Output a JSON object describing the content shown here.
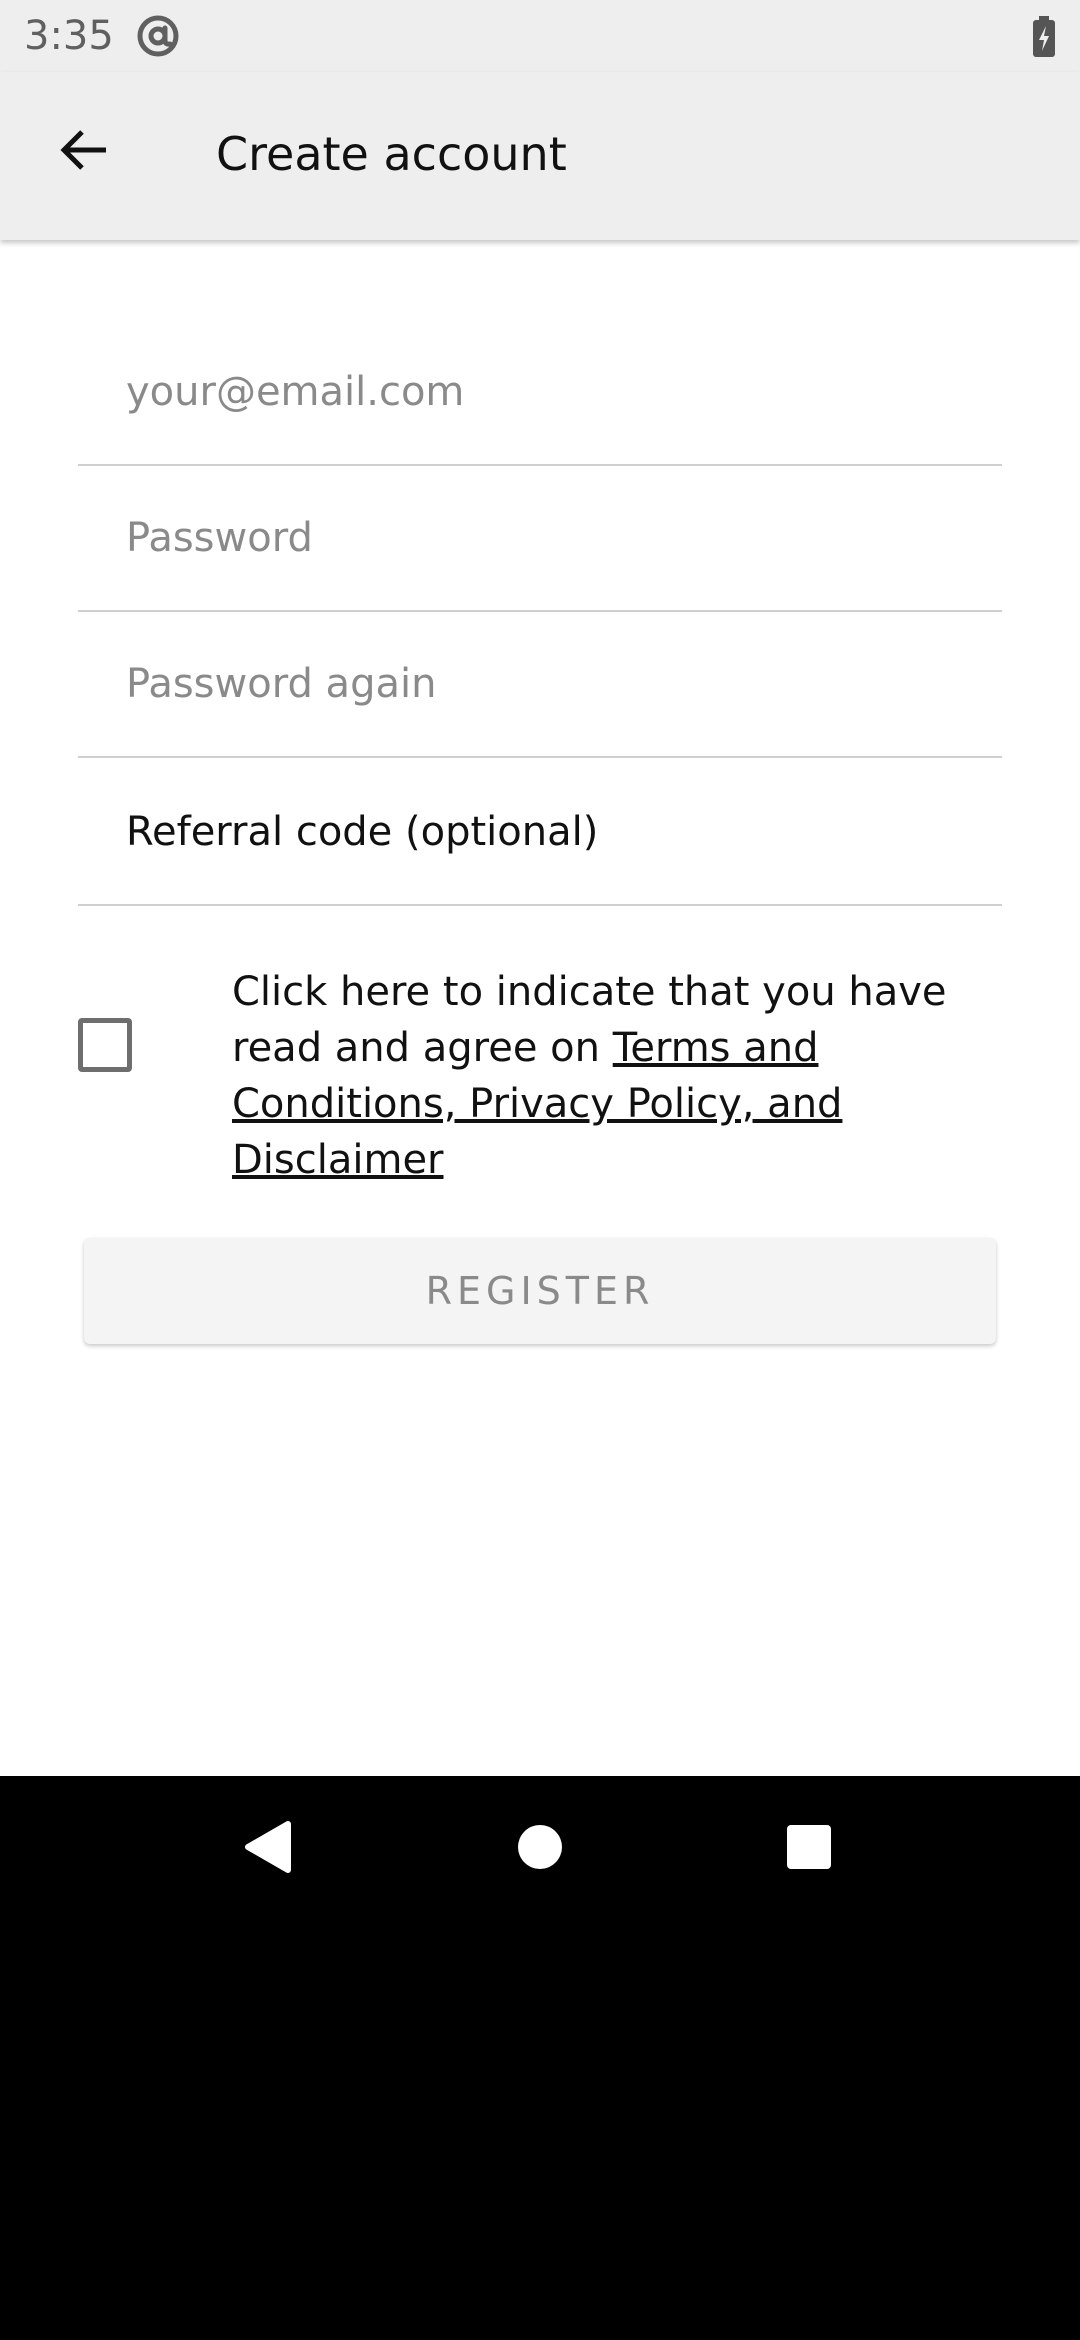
{
  "status_bar": {
    "time": "3:35",
    "app_icon": "at-sign-icon",
    "battery_icon": "battery-charging-icon"
  },
  "app_bar": {
    "back_icon": "arrow-back-icon",
    "title": "Create account"
  },
  "form": {
    "email": {
      "value": "",
      "placeholder": "your@email.com"
    },
    "password": {
      "value": "",
      "placeholder": "Password"
    },
    "password_again": {
      "value": "",
      "placeholder": "Password again"
    },
    "referral": {
      "value": "",
      "placeholder": "Referral code (optional)"
    },
    "agree": {
      "checked": false,
      "text_before": "Click here to indicate that you have read and agree on ",
      "link_text": "Terms and Conditions, Privacy Policy, and Disclaimer"
    },
    "register_label": "REGISTER"
  },
  "nav_bar": {
    "back": "nav-back-icon",
    "home": "nav-home-icon",
    "recents": "nav-recents-icon"
  },
  "colors": {
    "bar_background": "#eeeeee",
    "content_background": "#ffffff",
    "button_text_disabled": "#8a8a8a"
  }
}
